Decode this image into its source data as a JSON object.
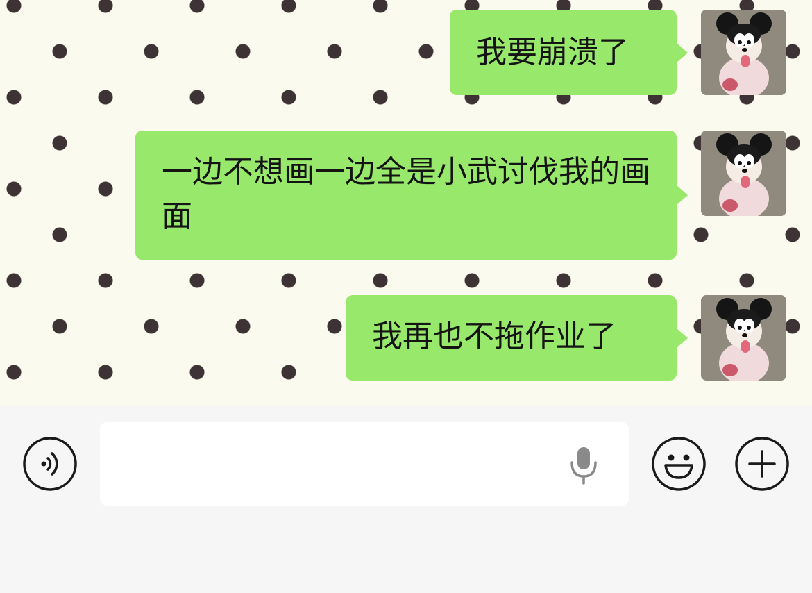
{
  "chat": {
    "messages": [
      {
        "sender": "me",
        "text": "我要崩溃了",
        "avatar_icon": "mickey-hat-girl-avatar"
      },
      {
        "sender": "me",
        "text": "一边不想画一边全是小武讨伐我的画面",
        "avatar_icon": "mickey-hat-girl-avatar"
      },
      {
        "sender": "me",
        "text": "我再也不拖作业了",
        "avatar_icon": "mickey-hat-girl-avatar"
      }
    ],
    "background": "polka-dot",
    "bubble_color": "#98e86c"
  },
  "input_bar": {
    "message_value": "",
    "icons": {
      "voice": "voice-toggle-icon",
      "mic": "microphone-icon",
      "emoji": "smiley-icon",
      "plus": "plus-icon"
    }
  }
}
